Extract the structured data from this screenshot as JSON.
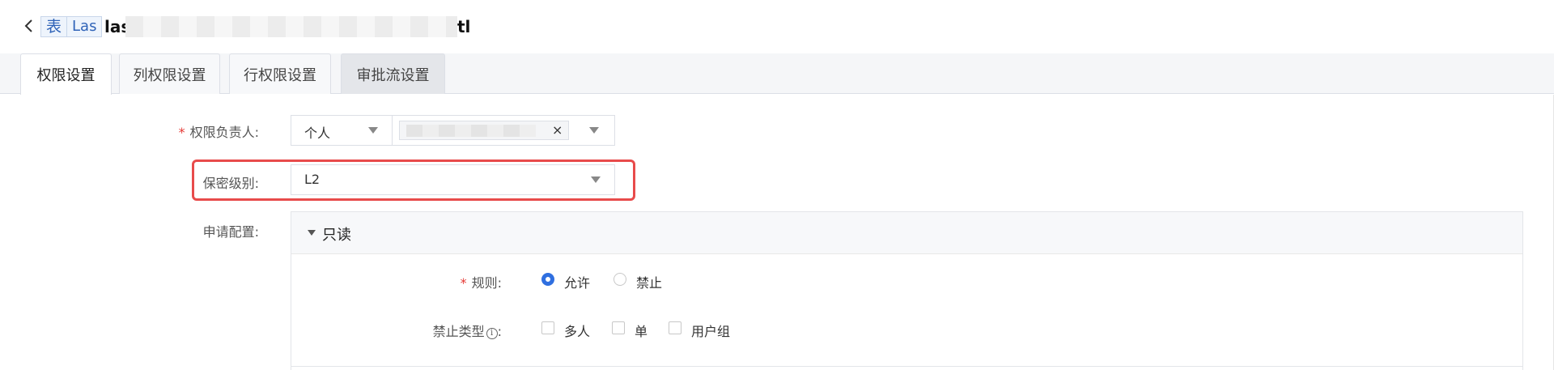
{
  "header": {
    "tag_type": "表",
    "tag_engine": "Las",
    "title_start": "las",
    "title_end": "tl"
  },
  "tabs": [
    {
      "label": "权限设置",
      "active": true
    },
    {
      "label": "列权限设置",
      "active": false
    },
    {
      "label": "行权限设置",
      "active": false
    },
    {
      "label": "审批流设置",
      "active": false
    }
  ],
  "form": {
    "owner": {
      "required_mark": "*",
      "label": "权限负责人:",
      "type_value": "个人",
      "clear_glyph": "×"
    },
    "secrecy": {
      "label": "保密级别:",
      "value": "L2"
    },
    "apply": {
      "label": "申请配置:"
    }
  },
  "panel": {
    "title": "只读",
    "rule": {
      "required_mark": "*",
      "label": "规则:",
      "options": [
        "允许",
        "禁止"
      ],
      "selected": "允许"
    },
    "forbid": {
      "label": "禁止类型",
      "info_glyph": "i",
      "colon": ":",
      "options": [
        "多人",
        "单",
        "用户组"
      ]
    }
  },
  "colors": {
    "accent": "#2f6fe0",
    "highlight": "#e84b4b",
    "required": "#e53935"
  }
}
